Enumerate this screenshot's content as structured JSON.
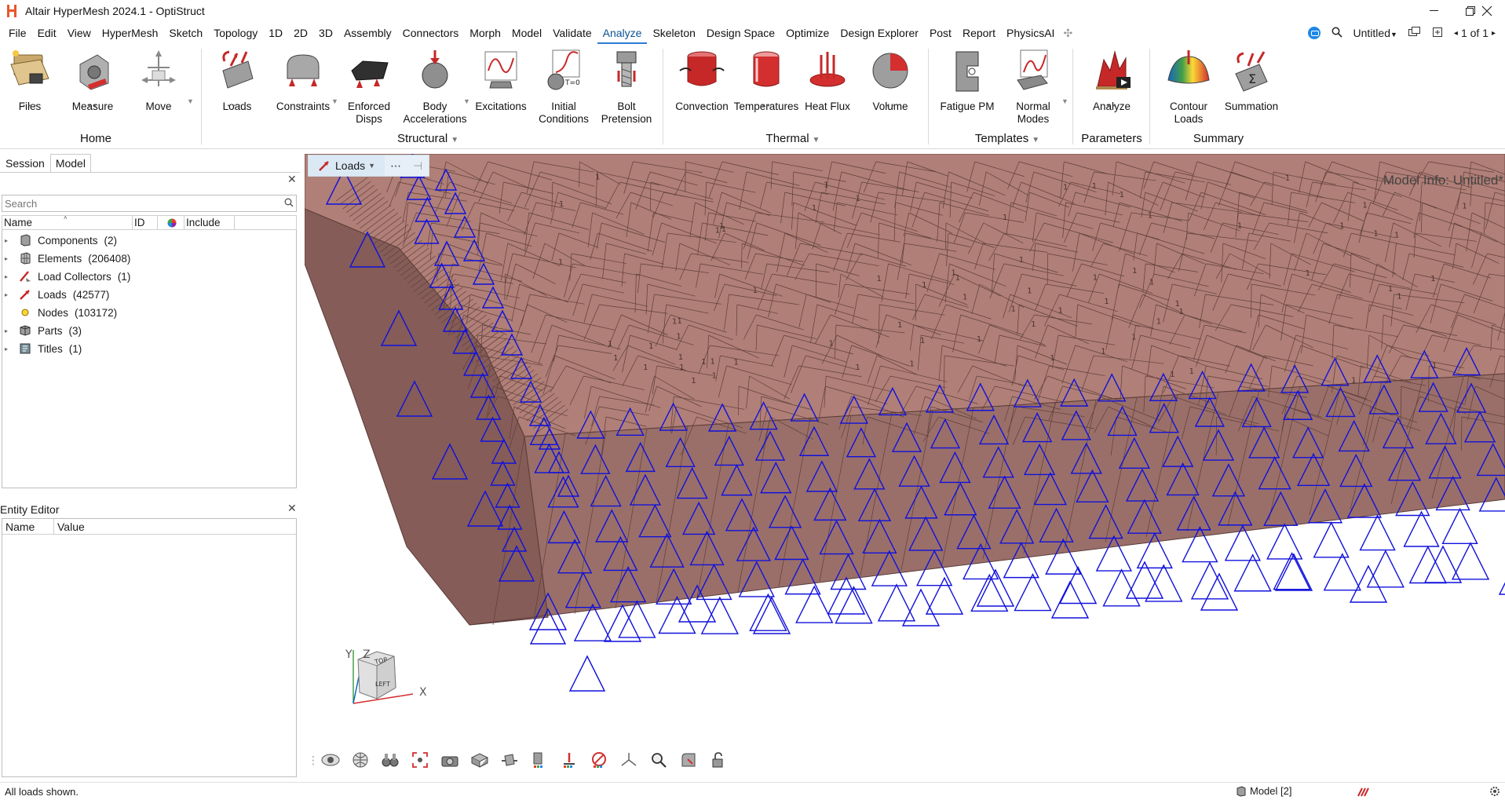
{
  "window": {
    "title": "Altair HyperMesh 2024.1 - OptiStruct",
    "controls": [
      "minimize",
      "restore",
      "close"
    ]
  },
  "menubar": {
    "items": [
      "File",
      "Edit",
      "View",
      "HyperMesh",
      "Sketch",
      "Topology",
      "1D",
      "2D",
      "3D",
      "Assembly",
      "Connectors",
      "Morph",
      "Model",
      "Validate",
      "Analyze",
      "Skeleton",
      "Design Space",
      "Optimize",
      "Design Explorer",
      "Post",
      "Report",
      "PhysicsAI"
    ],
    "active": "Analyze",
    "right": {
      "session_name": "Untitled",
      "page": "1 of 1"
    }
  },
  "ribbon": {
    "buttons": [
      {
        "id": "files",
        "label": "Files"
      },
      {
        "id": "measure",
        "label": "Measure"
      },
      {
        "id": "move",
        "label": "Move"
      },
      {
        "id": "loads",
        "label": "Loads"
      },
      {
        "id": "constraints",
        "label": "Constraints"
      },
      {
        "id": "enforced",
        "label": "Enforced\nDisps"
      },
      {
        "id": "bodyacc",
        "label": "Body\nAccelerations"
      },
      {
        "id": "excitations",
        "label": "Excitations"
      },
      {
        "id": "initial",
        "label": "Initial\nConditions"
      },
      {
        "id": "bolt",
        "label": "Bolt\nPretension"
      },
      {
        "id": "convection",
        "label": "Convection"
      },
      {
        "id": "temperatures",
        "label": "Temperatures"
      },
      {
        "id": "heatflux",
        "label": "Heat Flux"
      },
      {
        "id": "volume",
        "label": "Volume"
      },
      {
        "id": "fatigue",
        "label": "Fatigue PM"
      },
      {
        "id": "normalmodes",
        "label": "Normal\nModes"
      },
      {
        "id": "analyze",
        "label": "Analyze"
      },
      {
        "id": "contourloads",
        "label": "Contour\nLoads"
      },
      {
        "id": "summation",
        "label": "Summation"
      }
    ],
    "groups": [
      "Home",
      "Structural",
      "Thermal",
      "Templates",
      "Parameters",
      "Summary"
    ]
  },
  "left_panel": {
    "tabs": [
      "Session",
      "Model"
    ],
    "active_tab": "Model",
    "search_placeholder": "Search",
    "columns": [
      "Name",
      "ID",
      "Include"
    ],
    "tree": [
      {
        "name": "Components",
        "count": "(2)",
        "icon": "component-icon"
      },
      {
        "name": "Elements",
        "count": "(206408)",
        "icon": "elements-icon"
      },
      {
        "name": "Load Collectors",
        "count": "(1)",
        "icon": "load-collector-icon"
      },
      {
        "name": "Loads",
        "count": "(42577)",
        "icon": "loads-icon"
      },
      {
        "name": "Nodes",
        "count": "(103172)",
        "icon": "nodes-icon"
      },
      {
        "name": "Parts",
        "count": "(3)",
        "icon": "parts-icon"
      },
      {
        "name": "Titles",
        "count": "(1)",
        "icon": "titles-icon"
      }
    ],
    "entity_editor": {
      "title": "Entity Editor",
      "columns": [
        "Name",
        "Value"
      ]
    }
  },
  "viewport": {
    "toolbar_selector": "Loads",
    "model_info": "Model Info: Untitled*",
    "triad": {
      "x": "X",
      "y": "Y",
      "z": "Z",
      "cube_top": "TOP",
      "cube_side": "LEFT"
    },
    "mesh_label": "1",
    "colors": {
      "mesh_fill": "#b07f77",
      "mesh_dark": "#855c57",
      "constraint": "#1111dd"
    }
  },
  "statusbar": {
    "message": "All loads shown.",
    "model": "Model [2]"
  }
}
